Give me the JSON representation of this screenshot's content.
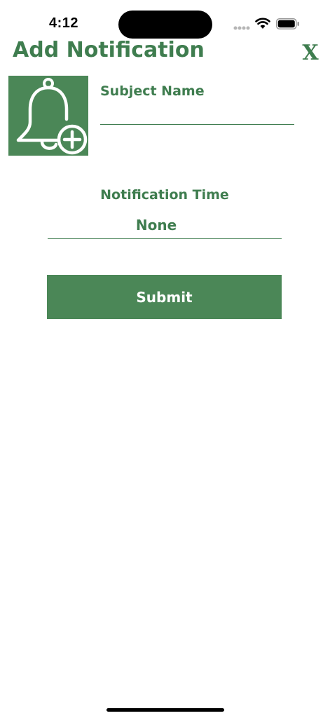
{
  "status_bar": {
    "time": "4:12",
    "icons": [
      "cellular-signal-icon",
      "wifi-icon",
      "battery-icon"
    ]
  },
  "header": {
    "title": "Add Notification",
    "close_label": "X"
  },
  "form": {
    "image_icon": "bell-plus-icon",
    "subject_label": "Subject Name",
    "subject_value": "",
    "subject_placeholder": "",
    "time_label": "Notification Time",
    "time_value": "None",
    "submit_label": "Submit"
  },
  "colors": {
    "accent": "#3f7d4f",
    "button_bg": "#4b8757",
    "button_text": "#ffffff",
    "background": "#ffffff"
  }
}
